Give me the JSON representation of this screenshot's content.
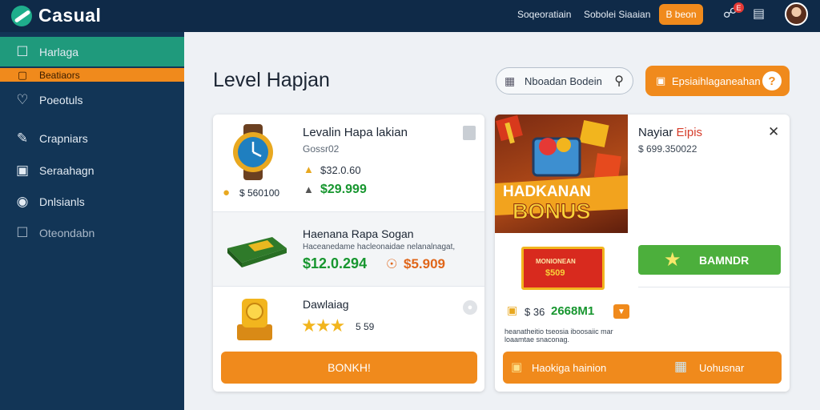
{
  "app": {
    "logo_text": "Casual"
  },
  "topbar": {
    "links": [
      "Soqeoratiain",
      "Sobolei Siaaian"
    ],
    "button_label": "B beon",
    "notification_count": "E"
  },
  "sidebar": {
    "items": [
      {
        "label": "Harlaga",
        "icon": "square-icon"
      },
      {
        "label": "Beatiaors",
        "icon": ""
      },
      {
        "label": "Poeotuls",
        "icon": "heart-icon"
      },
      {
        "label": "Crapniars",
        "icon": "pencil-icon"
      },
      {
        "label": "Seraahagn",
        "icon": "card-icon"
      },
      {
        "label": "Dnlsianls",
        "icon": "disc-icon"
      },
      {
        "label": "Oteondabn",
        "icon": "square-icon"
      }
    ]
  },
  "main": {
    "title": "Level Hapjan",
    "search_text": "Nboadan Bodein",
    "cta_label": "Epsiaihlaganeahan",
    "cta_icon": "?"
  },
  "left_panel": {
    "item1": {
      "title": "Levalin Hapa lakian",
      "subtitle": "Gossr02",
      "badge_value": "$ 560100",
      "old_price": "$32.0.60",
      "new_price": "$29.999"
    },
    "item2": {
      "title": "Haenana Rapa Sogan",
      "desc": "Haceanedame hacleonaidae nelanalnagat,",
      "price_green": "$12.0.294",
      "price_orange": "$5.909"
    },
    "item3": {
      "title": "Dawlaiag",
      "rating": 3,
      "rating_text": "5 59",
      "button_label": "BONKH!"
    }
  },
  "right_panel": {
    "promo_line1": "HADKANAN",
    "promo_line2": "BONUS",
    "title_black": "Nayiar",
    "title_red": "Eipis",
    "subtitle": "$ 699.350022",
    "close_icon": "✕",
    "ticket_text": "MONIONEAN",
    "ticket_price": "$509",
    "green_button": "BAMNDR",
    "stat_prefix": "$ 36",
    "stat_value": "2668M1",
    "note": "heanatheitio tseosia iboosaiic mar loaamtae snaconag.",
    "bottom_left": "Haokiga hainion",
    "bottom_right": "Uohusnar"
  },
  "colors": {
    "accent": "#f08a1c",
    "nav": "#123556",
    "active": "#1f9a7c",
    "green": "#4caf3c"
  }
}
